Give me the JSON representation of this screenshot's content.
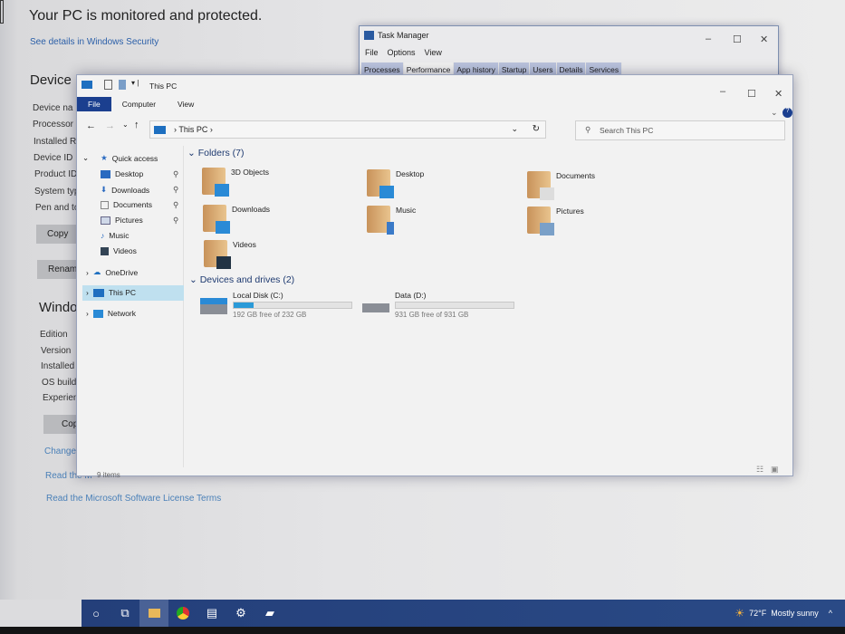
{
  "settings": {
    "headline": "Your PC is monitored and protected.",
    "security_link": "See details in Windows Security",
    "device_heading": "Device",
    "device_rows": [
      "Device na",
      "Processor",
      "Installed R",
      "Device ID",
      "Product ID",
      "System typ",
      "Pen and to"
    ],
    "copy_btn": "Copy",
    "rename_btn": "Rename",
    "windows_heading": "Window",
    "windows_rows": [
      "Edition",
      "Version",
      "Installed o",
      "OS build",
      "Experience"
    ],
    "copy_btn2": "Copy",
    "change_link": "Change pr",
    "read_link1": "Read the M",
    "read_link2": "Read the Microsoft Software License Terms"
  },
  "task_manager": {
    "title": "Task Manager",
    "menu": [
      "File",
      "Options",
      "View"
    ],
    "tabs": [
      "Processes",
      "Performance",
      "App history",
      "Startup",
      "Users",
      "Details",
      "Services"
    ],
    "active_tab": "Performance"
  },
  "explorer": {
    "title": "This PC",
    "ribbon": [
      "File",
      "Computer",
      "View"
    ],
    "address": [
      "This PC"
    ],
    "search_placeholder": "Search This PC",
    "nav": {
      "quick_access": "Quick access",
      "pinned": [
        "Desktop",
        "Downloads",
        "Documents",
        "Pictures"
      ],
      "unpinned": [
        "Music",
        "Videos"
      ],
      "onedrive": "OneDrive",
      "this_pc": "This PC",
      "network": "Network"
    },
    "folders_heading": "Folders (7)",
    "folders": [
      "3D Objects",
      "Desktop",
      "Documents",
      "Downloads",
      "Music",
      "Pictures",
      "Videos"
    ],
    "drives_heading": "Devices and drives (2)",
    "drives": [
      {
        "name": "Local Disk (C:)",
        "free": "192 GB free of 232 GB",
        "used_fraction": 0.17
      },
      {
        "name": "Data (D:)",
        "free": "931 GB free of 931 GB",
        "used_fraction": 0.0
      }
    ],
    "status": "9 items"
  },
  "taskbar": {
    "weather": "72°F",
    "condition": "Mostly sunny"
  }
}
